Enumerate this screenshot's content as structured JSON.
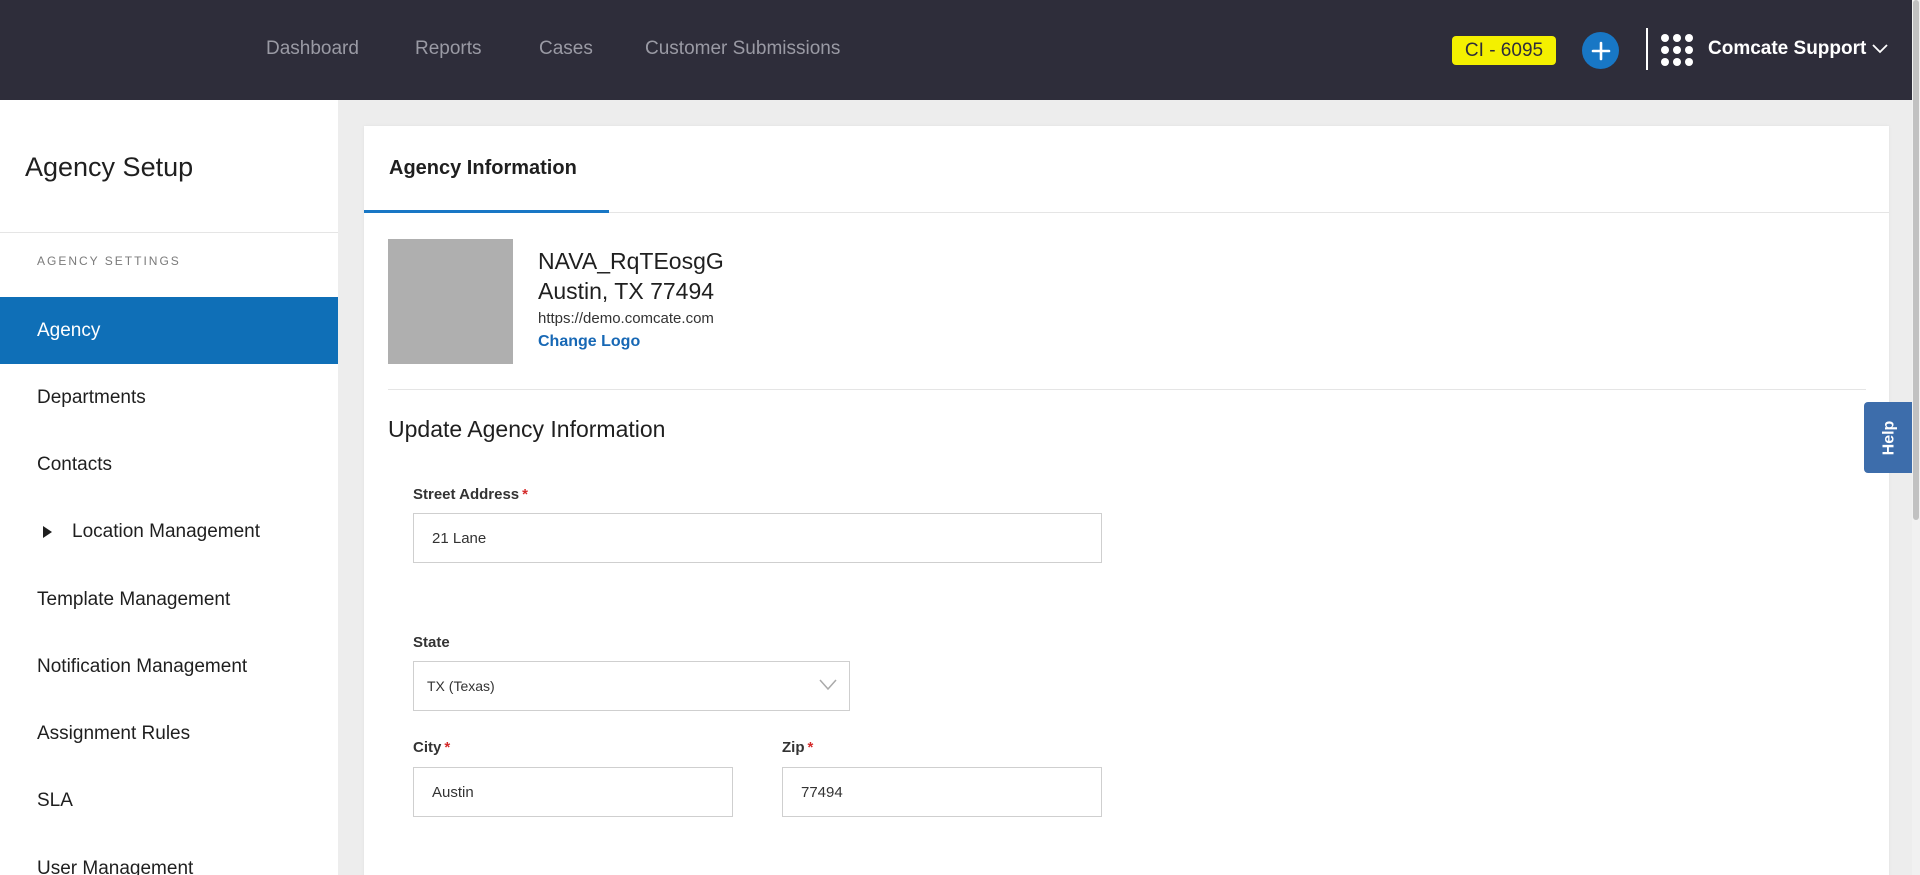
{
  "topbar": {
    "nav": [
      "Dashboard",
      "Reports",
      "Cases",
      "Customer Submissions"
    ],
    "ci_badge": "CI - 6095",
    "account_name": "Comcate Support",
    "icons": {
      "add": "plus-icon",
      "apps": "apps-grid-icon",
      "account_menu": "chevron-down-icon"
    },
    "colors": {
      "bar": "#2e2d3a",
      "badge": "#f4f000",
      "add": "#1877c5"
    }
  },
  "sidebar": {
    "title": "Agency Setup",
    "section_label": "AGENCY SETTINGS",
    "items": [
      {
        "label": "Agency",
        "active": true
      },
      {
        "label": "Departments"
      },
      {
        "label": "Contacts"
      },
      {
        "label": "Location Management",
        "expandable": true
      },
      {
        "label": "Template Management"
      },
      {
        "label": "Notification Management"
      },
      {
        "label": "Assignment Rules"
      },
      {
        "label": "SLA"
      },
      {
        "label": "User Management"
      }
    ],
    "active_color": "#0f6fb7"
  },
  "main": {
    "tab_label": "Agency Information",
    "agency": {
      "name": "NAVA_RqTEosgG",
      "city_line": "Austin, TX 77494",
      "url": "https://demo.comcate.com",
      "change_logo": "Change Logo"
    },
    "update_title": "Update Agency Information",
    "form": {
      "street": {
        "label": "Street Address",
        "required_mark": "*",
        "value": "21 Lane"
      },
      "state": {
        "label": "State",
        "value": "TX (Texas)"
      },
      "city": {
        "label": "City",
        "required_mark": "*",
        "value": "Austin"
      },
      "zip": {
        "label": "Zip",
        "required_mark": "*",
        "value": "77494"
      }
    }
  },
  "help": {
    "label": "Help"
  }
}
